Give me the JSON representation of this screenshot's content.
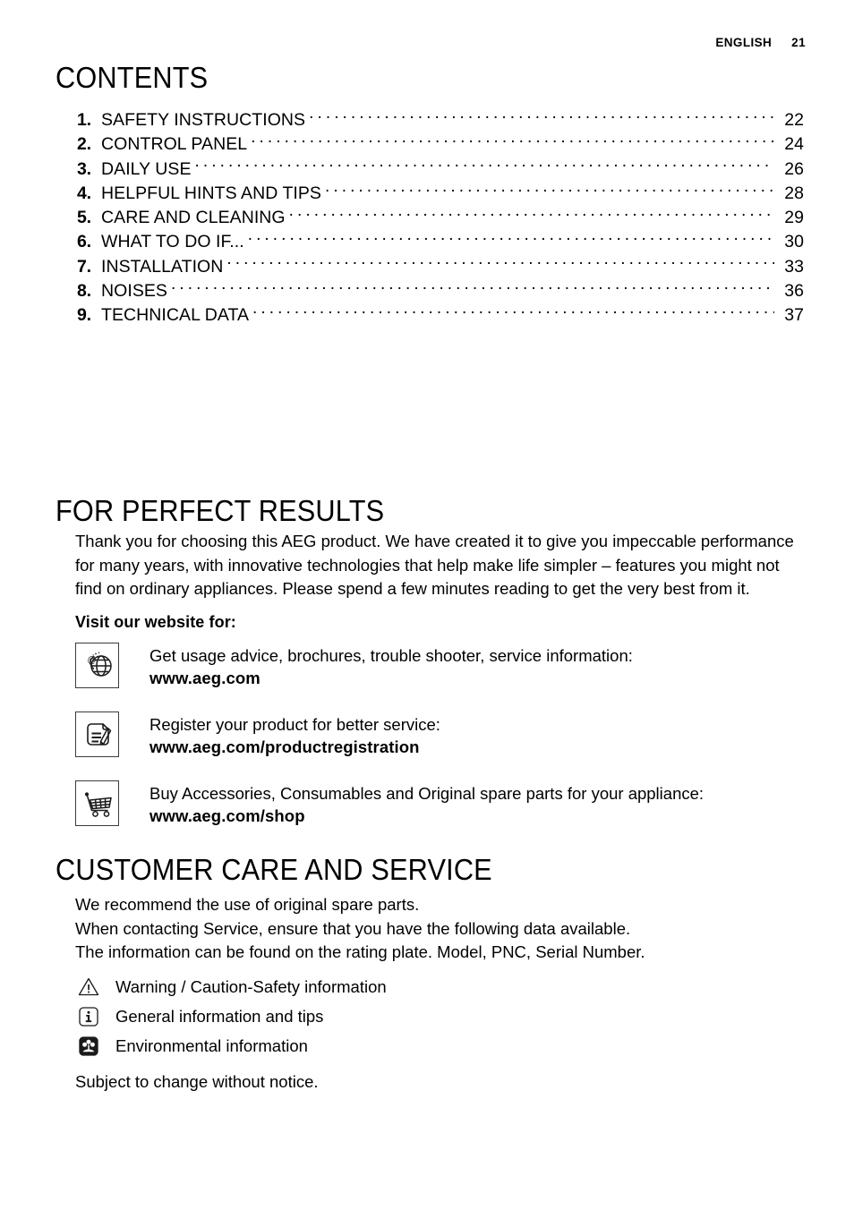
{
  "header": {
    "language": "ENGLISH",
    "page_number": "21"
  },
  "contents": {
    "heading": "CONTENTS",
    "entries": [
      {
        "number": "1.",
        "title": "SAFETY INSTRUCTIONS",
        "page": "22"
      },
      {
        "number": "2.",
        "title": "CONTROL PANEL",
        "page": "24"
      },
      {
        "number": "3.",
        "title": "DAILY USE",
        "page": "26"
      },
      {
        "number": "4.",
        "title": "HELPFUL HINTS AND TIPS",
        "page": "28"
      },
      {
        "number": "5.",
        "title": "CARE AND CLEANING",
        "page": "29"
      },
      {
        "number": "6.",
        "title": "WHAT TO DO IF...",
        "page": "30"
      },
      {
        "number": "7.",
        "title": "INSTALLATION",
        "page": "33"
      },
      {
        "number": "8.",
        "title": "NOISES",
        "page": "36"
      },
      {
        "number": "9.",
        "title": "TECHNICAL DATA",
        "page": "37"
      }
    ]
  },
  "perfect_results": {
    "heading": "FOR PERFECT RESULTS",
    "paragraph": "Thank you for choosing this AEG product. We have created it to give you impeccable performance for many years, with innovative technologies that help make life simpler – features you might not find on ordinary appliances. Please spend a few minutes reading to get the very best from it.",
    "visit_label": "Visit our website for:",
    "services": [
      {
        "icon": "globe-at-icon",
        "description": "Get usage advice, brochures, trouble shooter, service information:",
        "url": "www.aeg.com"
      },
      {
        "icon": "document-pencil-icon",
        "description": "Register your product for better service:",
        "url": "www.aeg.com/productregistration"
      },
      {
        "icon": "shopping-cart-icon",
        "description": "Buy Accessories, Consumables and Original spare parts for your appliance:",
        "url": "www.aeg.com/shop"
      }
    ]
  },
  "customer_care": {
    "heading": "CUSTOMER CARE AND SERVICE",
    "lines": [
      "We recommend the use of original spare parts.",
      "When contacting Service, ensure that you have the following data available.",
      "The information can be found on the rating plate. Model, PNC, Serial Number."
    ],
    "paragraph": "We recommend the use of original spare parts.\nWhen contacting Service, ensure that you have the following data available.\nThe information can be found on the rating plate. Model, PNC, Serial Number.",
    "legend": [
      {
        "icon": "warning-triangle-icon",
        "label": "Warning / Caution-Safety information"
      },
      {
        "icon": "information-icon",
        "label": "General information and tips"
      },
      {
        "icon": "environmental-flower-icon",
        "label": "Environmental information"
      }
    ],
    "note": "Subject to change without notice."
  },
  "colors": {
    "text": "#000000",
    "background": "#ffffff",
    "icon_stroke": "#1a1a1a",
    "frame_border": "#3b3b3b"
  }
}
